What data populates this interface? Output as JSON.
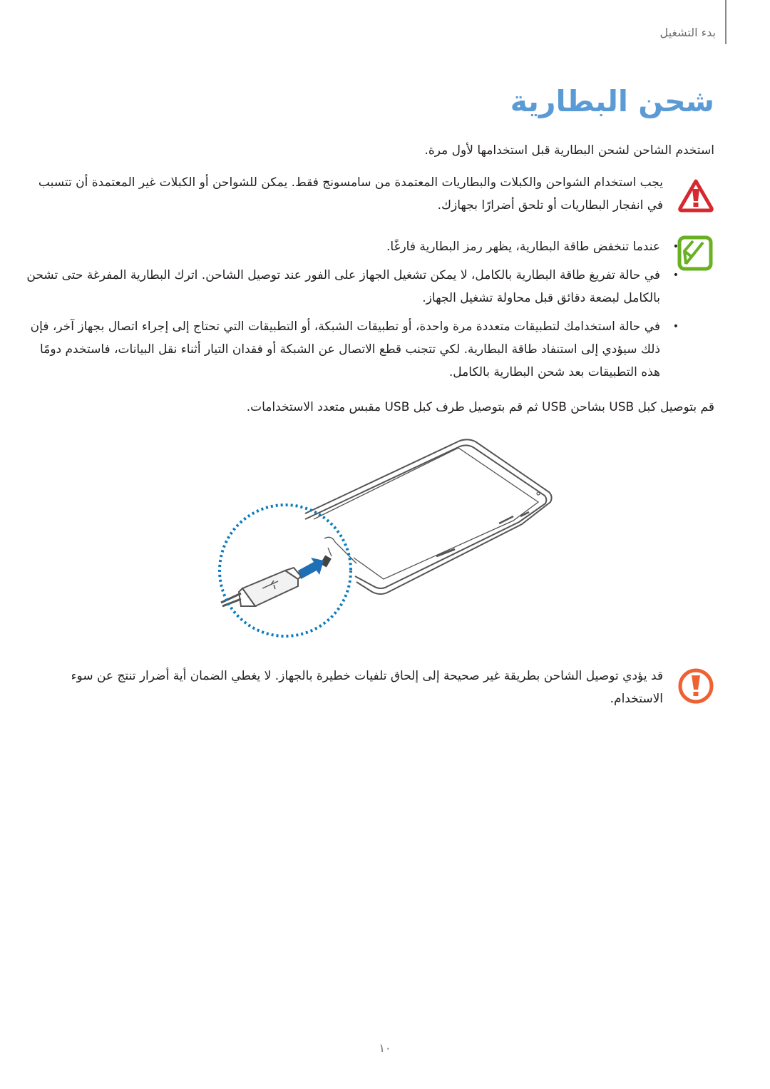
{
  "header": {
    "section_label": "بدء التشغيل"
  },
  "page": {
    "title": "شحن البطارية",
    "intro": "استخدم الشاحن لشحن البطارية قبل استخدامها لأول مرة.",
    "warning": {
      "icon": "warning-triangle-icon",
      "color": "#d7282f",
      "text": "يجب استخدام الشواحن والكبلات والبطاريات المعتمدة من سامسونج فقط. يمكن للشواحن أو الكبلات غير المعتمدة أن تتسبب في انفجار البطاريات أو تلحق أضرارًا بجهازك."
    },
    "note": {
      "icon": "note-pencil-icon",
      "color": "#6ab023",
      "bullets": [
        "عندما تنخفض طاقة البطارية، يظهر رمز البطارية فارغًا.",
        "في حالة تفريغ طاقة البطارية بالكامل، لا يمكن تشغيل الجهاز على الفور عند توصيل الشاحن. اترك البطارية المفرغة حتى تشحن بالكامل لبضعة دقائق قبل محاولة تشغيل الجهاز.",
        "في حالة استخدامك لتطبيقات متعددة مرة واحدة، أو تطبيقات الشبكة، أو التطبيقات التي تحتاج إلى إجراء اتصال بجهاز آخر، فإن ذلك سيؤدي إلى استنفاد طاقة البطارية. لكي تتجنب قطع الاتصال عن الشبكة أو فقدان التيار أثناء نقل البيانات، فاستخدم دومًا هذه التطبيقات بعد شحن البطارية بالكامل."
      ]
    },
    "instruction": "قم بتوصيل كبل USB بشاحن USB ثم قم بتوصيل طرف كبل USB مقبس متعدد الاستخدامات.",
    "illustration": {
      "description": "tablet-charging-usb-illustration",
      "highlight_color": "#0a7bbf",
      "arrow_color": "#1e6fb5"
    },
    "caution": {
      "icon": "caution-exclamation-icon",
      "color": "#ef6033",
      "text": "قد يؤدي توصيل الشاحن بطريقة غير صحيحة إلى إلحاق تلفيات خطيرة بالجهاز. لا يغطي الضمان أية أضرار تنتج عن سوء الاستخدام."
    }
  },
  "footer": {
    "page_number": "١٠"
  }
}
